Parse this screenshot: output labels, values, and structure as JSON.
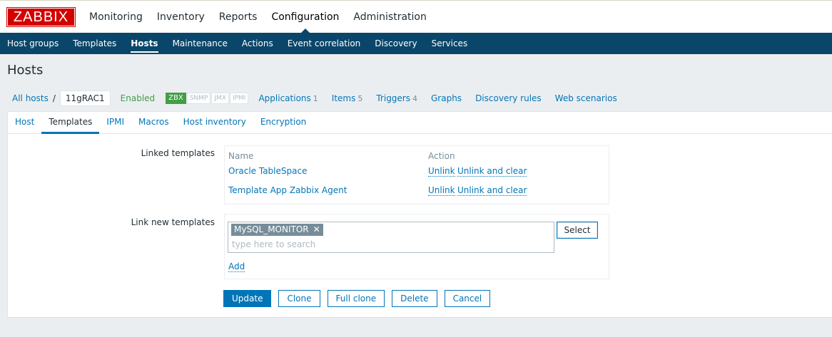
{
  "header": {
    "logo": "ZABBIX",
    "menu": [
      {
        "label": "Monitoring",
        "selected": false
      },
      {
        "label": "Inventory",
        "selected": false
      },
      {
        "label": "Reports",
        "selected": false
      },
      {
        "label": "Configuration",
        "selected": true
      },
      {
        "label": "Administration",
        "selected": false
      }
    ]
  },
  "submenu": [
    {
      "label": "Host groups",
      "selected": false
    },
    {
      "label": "Templates",
      "selected": false
    },
    {
      "label": "Hosts",
      "selected": true
    },
    {
      "label": "Maintenance",
      "selected": false
    },
    {
      "label": "Actions",
      "selected": false
    },
    {
      "label": "Event correlation",
      "selected": false
    },
    {
      "label": "Discovery",
      "selected": false
    },
    {
      "label": "Services",
      "selected": false
    }
  ],
  "page_title": "Hosts",
  "breadcrumb": {
    "all_hosts": "All hosts",
    "separator": "/",
    "current_host": "11gRAC1",
    "status": "Enabled",
    "availability": [
      "ZBX",
      "SNMP",
      "JMX",
      "IPMI"
    ],
    "applications": {
      "label": "Applications",
      "count": "1"
    },
    "items": {
      "label": "Items",
      "count": "5"
    },
    "triggers": {
      "label": "Triggers",
      "count": "4"
    },
    "graphs": "Graphs",
    "discovery_rules": "Discovery rules",
    "web_scenarios": "Web scenarios"
  },
  "tabs": [
    {
      "label": "Host",
      "selected": false
    },
    {
      "label": "Templates",
      "selected": true
    },
    {
      "label": "IPMI",
      "selected": false
    },
    {
      "label": "Macros",
      "selected": false
    },
    {
      "label": "Host inventory",
      "selected": false
    },
    {
      "label": "Encryption",
      "selected": false
    }
  ],
  "linked_templates": {
    "label": "Linked templates",
    "col_name": "Name",
    "col_action": "Action",
    "rows": [
      {
        "name": "Oracle TableSpace",
        "unlink": "Unlink",
        "unlink_clear": "Unlink and clear"
      },
      {
        "name": "Template App Zabbix Agent",
        "unlink": "Unlink",
        "unlink_clear": "Unlink and clear"
      }
    ]
  },
  "link_new": {
    "label": "Link new templates",
    "selected_tag": "MySQL_MONITOR",
    "placeholder": "type here to search",
    "select_button": "Select",
    "add_link": "Add"
  },
  "buttons": {
    "update": "Update",
    "clone": "Clone",
    "full_clone": "Full clone",
    "delete": "Delete",
    "cancel": "Cancel"
  },
  "colors": {
    "brand_red": "#d40000",
    "nav_blue": "#0a466a",
    "link_blue": "#0275b8",
    "enabled_green": "#429e47"
  }
}
